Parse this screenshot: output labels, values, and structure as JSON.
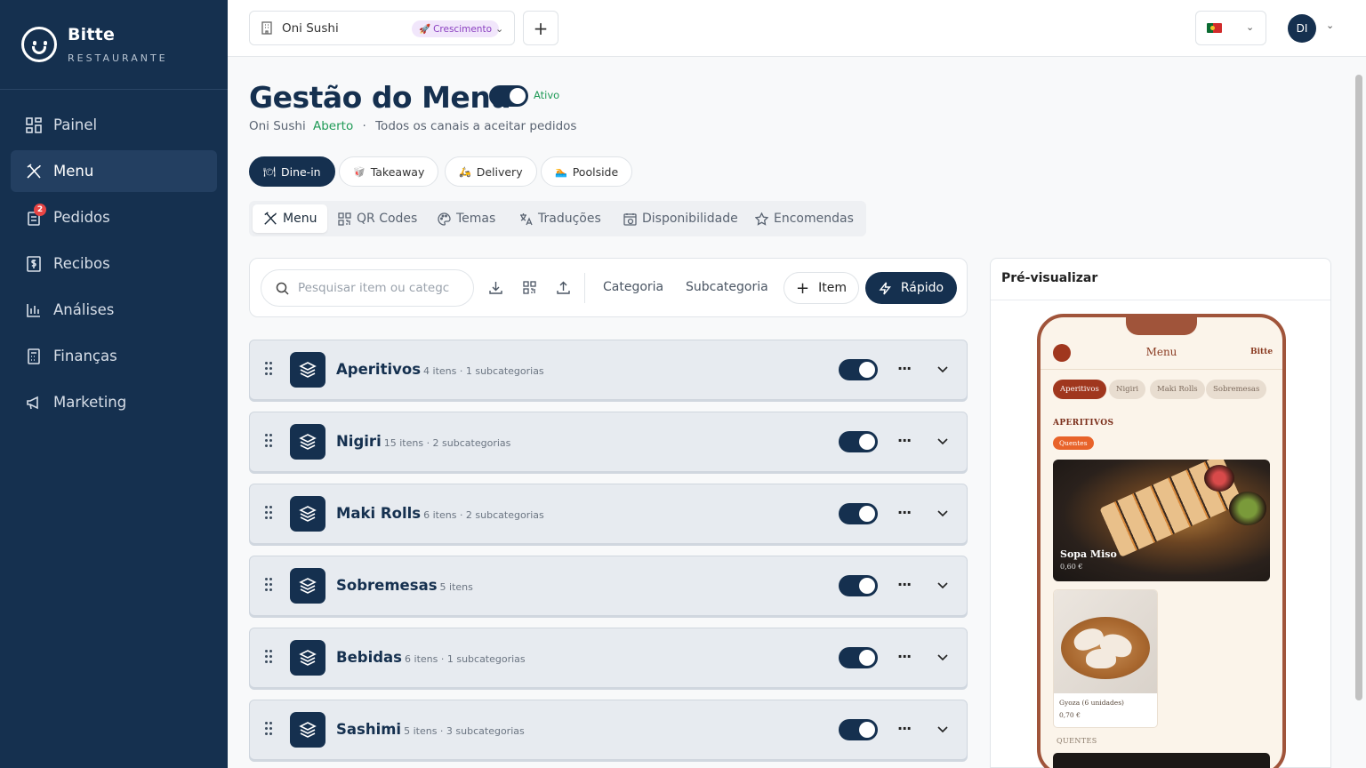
{
  "brand": {
    "name": "Bitte",
    "tagline": "RESTAURANTE"
  },
  "sidebar": {
    "items": [
      {
        "label": "Painel",
        "icon": "dashboard-icon"
      },
      {
        "label": "Menu",
        "icon": "utensils-icon",
        "active": true
      },
      {
        "label": "Pedidos",
        "icon": "orders-icon",
        "badge": "2"
      },
      {
        "label": "Recibos",
        "icon": "receipt-icon"
      },
      {
        "label": "Análises",
        "icon": "bar-chart-icon"
      },
      {
        "label": "Finanças",
        "icon": "calculator-icon"
      },
      {
        "label": "Marketing",
        "icon": "megaphone-icon"
      }
    ]
  },
  "topbar": {
    "store": "Oni Sushi",
    "plan": "Crescimento",
    "add": "+",
    "language": "pt",
    "user_initials": "DI"
  },
  "header": {
    "title": "Gestão do Menu",
    "status": "Ativo",
    "store": "Oni Sushi",
    "open_status": "Aberto",
    "separator": "·",
    "channels_note": "Todos os canais a aceitar pedidos"
  },
  "channels": [
    {
      "label": "Dine-in",
      "icon": "🍽",
      "active": true
    },
    {
      "label": "Takeaway",
      "icon": "🥡"
    },
    {
      "label": "Delivery",
      "icon": "🛵"
    },
    {
      "label": "Poolside",
      "icon": "🏊"
    }
  ],
  "tabs": [
    {
      "label": "Menu",
      "icon": "utensils-icon",
      "active": true
    },
    {
      "label": "QR Codes",
      "icon": "qr-code-icon"
    },
    {
      "label": "Temas",
      "icon": "palette-icon"
    },
    {
      "label": "Traduções",
      "icon": "translate-icon"
    },
    {
      "label": "Disponibilidade",
      "icon": "calendar-clock-icon"
    },
    {
      "label": "Encomendas",
      "icon": "star-icon"
    }
  ],
  "toolbar": {
    "search_placeholder": "Pesquisar item ou categc",
    "category": "Categoria",
    "subcategory": "Subcategoria",
    "item": "Item",
    "quick": "Rápido"
  },
  "categories": [
    {
      "name": "Aperitivos",
      "meta": "4 itens · 1 subcategorias",
      "enabled": true
    },
    {
      "name": "Nigiri",
      "meta": "15 itens · 2 subcategorias",
      "enabled": true
    },
    {
      "name": "Maki Rolls",
      "meta": "6 itens · 2 subcategorias",
      "enabled": true
    },
    {
      "name": "Sobremesas",
      "meta": "5 itens",
      "enabled": true
    },
    {
      "name": "Bebidas",
      "meta": "6 itens · 1 subcategorias",
      "enabled": true
    },
    {
      "name": "Sashimi",
      "meta": "5 itens · 3 subcategorias",
      "enabled": true
    }
  ],
  "preview": {
    "title": "Pré-visualizar",
    "phone": {
      "header": "Menu",
      "brand": "Bitte",
      "pills": [
        "Aperitivos",
        "Nigiri",
        "Maki Rolls",
        "Sobremesas"
      ],
      "section": "APERITIVOS",
      "tag": "Quentes",
      "items": [
        {
          "name": "Sopa Miso",
          "price": "0,60 €"
        },
        {
          "name": "Gyoza (6 unidades)",
          "price": "0,70 €"
        }
      ],
      "subsection": "QUENTES"
    }
  },
  "colors": {
    "navy": "#15304f",
    "green": "#1f9a56",
    "accent": "#a0371e"
  }
}
